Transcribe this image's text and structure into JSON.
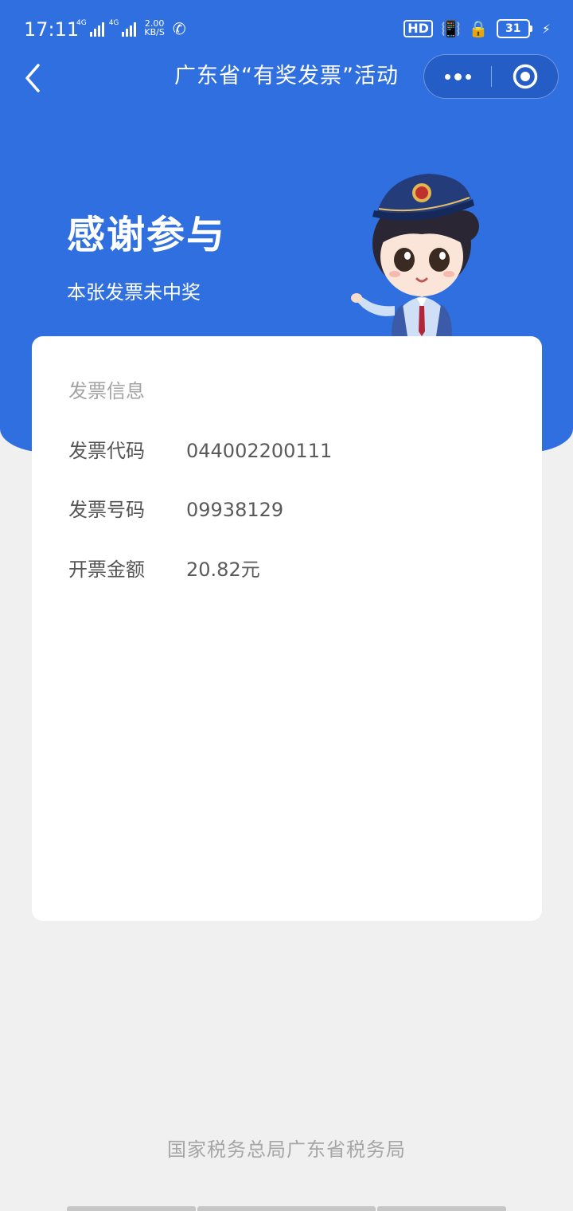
{
  "status_bar": {
    "time": "17:11",
    "signal_label_1": "4G",
    "signal_label_2": "4G",
    "net_speed_value": "2.00",
    "net_speed_unit": "KB/S",
    "hd_label": "HD",
    "battery": "31"
  },
  "nav": {
    "title": "广东省“有奖发票”活动"
  },
  "hero": {
    "title": "感谢参与",
    "subtitle": "本张发票未中奖"
  },
  "card": {
    "heading": "发票信息",
    "rows": [
      {
        "label": "发票代码",
        "value": "044002200111"
      },
      {
        "label": "发票号码",
        "value": "09938129"
      },
      {
        "label": "开票金额",
        "value": "20.82元"
      }
    ]
  },
  "footer": {
    "text": "国家税务总局广东省税务局"
  },
  "colors": {
    "primary_blue": "#2f6fe0",
    "page_background": "#f0f0f0",
    "card_background": "#ffffff",
    "muted_text": "#a3a3a3",
    "body_text": "#555555"
  },
  "icons": {
    "back": "chevron-left",
    "more": "three-dots",
    "close": "target-circle",
    "call": "phone-wifi",
    "vibrate": "vibrate-mute",
    "lock": "rotation-lock",
    "charging": "lightning"
  }
}
